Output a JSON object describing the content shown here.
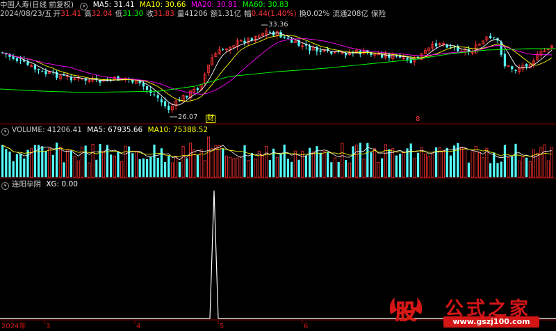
{
  "header1": {
    "stock_name": "中国人寿(日线 前复权)",
    "ma5": "MA5: 31.41",
    "ma10": "MA10: 30.66",
    "ma20": "MA20: 30.81",
    "ma60": "MA60: 30.83"
  },
  "header2": {
    "date": "2024/08/23/五",
    "open_label": "开",
    "open": "31.41",
    "high_label": "高",
    "high": "32.04",
    "low_label": "低",
    "low": "31.30",
    "close_label": "收",
    "close": "31.83",
    "vol_label": "量",
    "vol": "41206",
    "amt_label": "额",
    "amt": "1.31亿",
    "chg_label": "幅",
    "chg": "0.44(1.40%)",
    "turn_label": "换",
    "turn": "0.02%",
    "float_label": "流通",
    "float": "208亿",
    "industry": "保险"
  },
  "price_annotations": {
    "high_mark": "33.36",
    "low_mark": "26.07",
    "cai_marker": "财",
    "marker2": "8"
  },
  "volume_header": {
    "title": "VOLUME: 41206.41",
    "ma5": "MA5: 67935.66",
    "ma10": "MA10: 75388.52"
  },
  "indicator_header": {
    "title": "连阳孕阴",
    "xg": "XG: 0.00"
  },
  "xaxis": {
    "year": "2024年",
    "m3": "3",
    "m4": "4",
    "m5": "5",
    "m6": "6"
  },
  "watermark": {
    "gu": "股",
    "title": "公式之家",
    "url": "www.gszj100.com"
  },
  "colors": {
    "up": "#ff3333",
    "down": "#54fcfc",
    "ma5": "#ffffff",
    "ma10": "#ffff00",
    "ma20": "#ff00ff",
    "ma60": "#00ff00",
    "accent_red": "#d41616"
  }
}
